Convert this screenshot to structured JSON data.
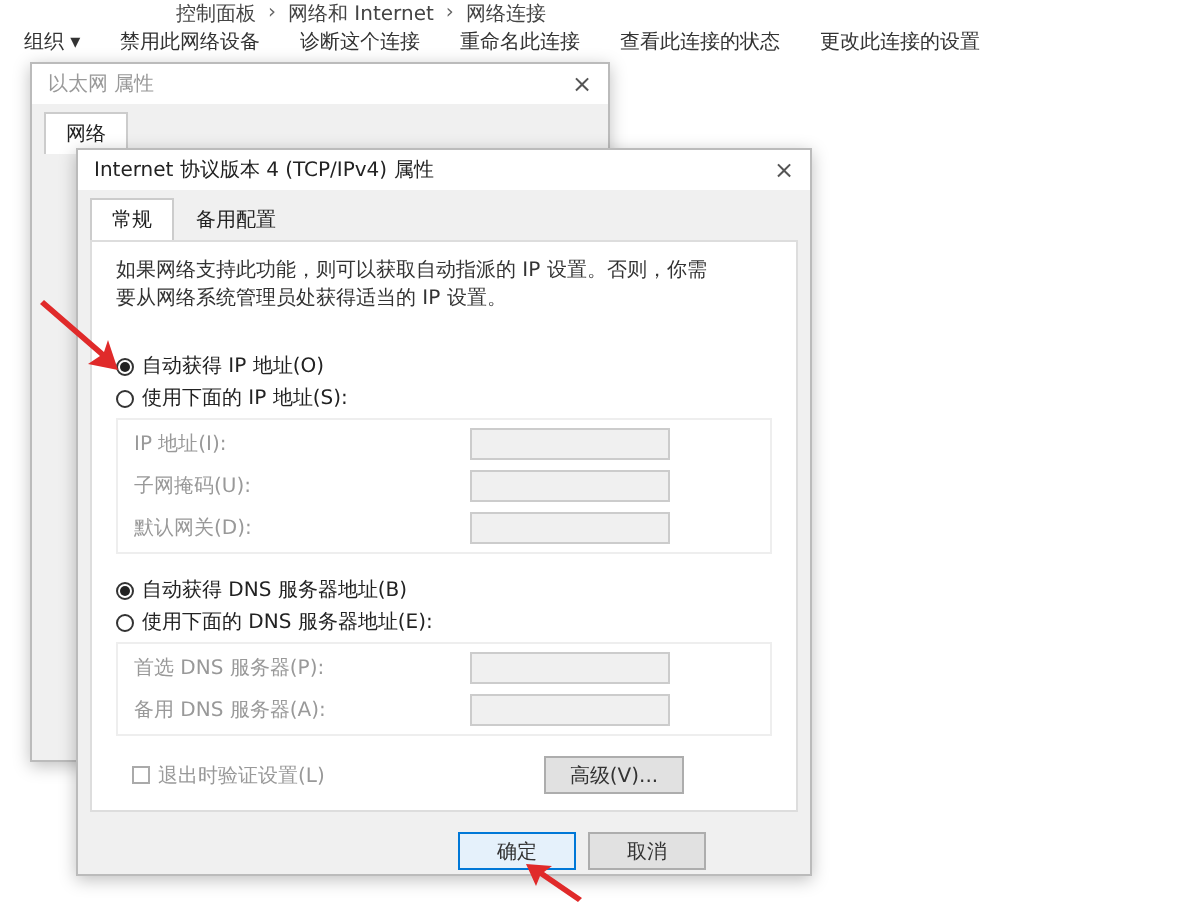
{
  "breadcrumb": {
    "items": [
      "控制面板",
      "网络和 Internet",
      "网络连接"
    ],
    "separators": [
      "›",
      "›"
    ]
  },
  "toolbar": [
    "组织 ▾",
    "禁用此网络设备",
    "诊断这个连接",
    "重命名此连接",
    "查看此连接的状态",
    "更改此连接的设置"
  ],
  "back_dialog": {
    "title": "以太网 属性",
    "close": "×",
    "tabs": [
      {
        "label": "网络",
        "selected": true
      }
    ]
  },
  "dialog": {
    "title": "Internet 协议版本 4 (TCP/IPv4) 属性",
    "close": "×",
    "tabs": [
      {
        "label": "常规",
        "selected": true
      },
      {
        "label": "备用配置",
        "selected": false
      }
    ],
    "description": "如果网络支持此功能，则可以获取自动指派的 IP 设置。否则，你需要从网络系统管理员处获得适当的 IP 设置。",
    "ip_options": [
      {
        "label": "自动获得 IP 地址(O)",
        "selected": true
      },
      {
        "label": "使用下面的 IP 地址(S):",
        "selected": false
      }
    ],
    "ip_fields": [
      {
        "label": "IP 地址(I):",
        "disabled": true
      },
      {
        "label": "子网掩码(U):",
        "disabled": true
      },
      {
        "label": "默认网关(D):",
        "disabled": true
      }
    ],
    "dns_options": [
      {
        "label": "自动获得 DNS 服务器地址(B)",
        "selected": true
      },
      {
        "label": "使用下面的 DNS 服务器地址(E):",
        "selected": false
      }
    ],
    "dns_fields": [
      {
        "label": "首选 DNS 服务器(P):",
        "disabled": true
      },
      {
        "label": "备用 DNS 服务器(A):",
        "disabled": true
      }
    ],
    "validate": {
      "label": "退出时验证设置(L)",
      "checked": false,
      "disabled": true
    },
    "advanced_button": "高级(V)...",
    "buttons": [
      {
        "label": "确定",
        "kind": "primary"
      },
      {
        "label": "取消",
        "kind": "normal"
      }
    ]
  }
}
